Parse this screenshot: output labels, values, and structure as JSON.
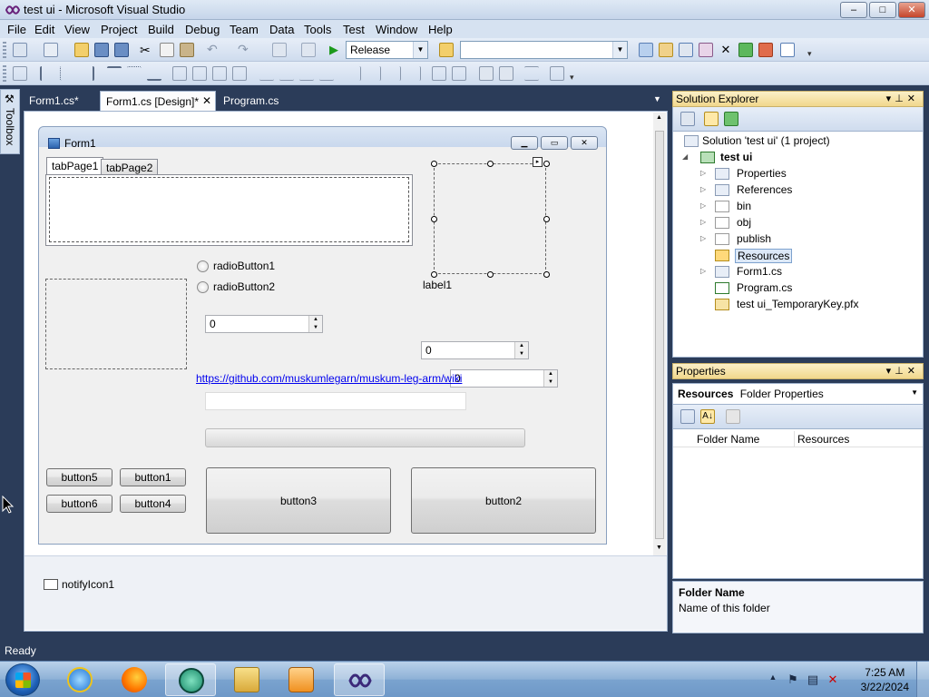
{
  "window": {
    "title": "test ui - Microsoft Visual Studio",
    "minimize": "‒",
    "maximize": "□",
    "close": "✕"
  },
  "menu": [
    "File",
    "Edit",
    "View",
    "Project",
    "Build",
    "Debug",
    "Team",
    "Data",
    "Tools",
    "Test",
    "Window",
    "Help"
  ],
  "toolbar": {
    "config_combo": "Release",
    "platform_combo": ""
  },
  "toolbox": {
    "label": "Toolbox"
  },
  "doc_tabs": [
    {
      "label": "Form1.cs*",
      "close": ""
    },
    {
      "label": "Form1.cs [Design]*",
      "close": "✕"
    },
    {
      "label": "Program.cs",
      "close": ""
    }
  ],
  "form": {
    "title": "Form1",
    "tabs": [
      "tabPage1",
      "tabPage2"
    ],
    "radio1": "radioButton1",
    "radio2": "radioButton2",
    "label1": "label1",
    "numeric1": "0",
    "numeric2": "0",
    "numeric3": "0",
    "link": "https://github.com/muskumlegarn/muskum-leg-arm/wiki",
    "buttons": {
      "b5": "button5",
      "b1": "button1",
      "b6": "button6",
      "b4": "button4",
      "b3": "button3",
      "b2": "button2"
    }
  },
  "component_tray": {
    "notify": "notifyIcon1"
  },
  "solution_explorer": {
    "title": "Solution Explorer",
    "items": [
      {
        "label": "Solution 'test ui' (1 project)",
        "twisty": ""
      },
      {
        "label": "test ui",
        "twisty": "◢"
      },
      {
        "label": "Properties",
        "twisty": "▷"
      },
      {
        "label": "References",
        "twisty": "▷"
      },
      {
        "label": "bin",
        "twisty": "▷"
      },
      {
        "label": "obj",
        "twisty": "▷"
      },
      {
        "label": "publish",
        "twisty": "▷"
      },
      {
        "label": "Resources",
        "twisty": ""
      },
      {
        "label": "Form1.cs",
        "twisty": "▷"
      },
      {
        "label": "Program.cs",
        "twisty": ""
      },
      {
        "label": "test ui_TemporaryKey.pfx",
        "twisty": ""
      }
    ]
  },
  "properties": {
    "title": "Properties",
    "object_name": "Resources",
    "object_type": "Folder Properties",
    "row_name": "Folder Name",
    "row_value": "Resources",
    "desc_title": "Folder Name",
    "desc_text": "Name of this folder"
  },
  "status": {
    "text": "Ready"
  },
  "clock": {
    "time": "7:25 AM",
    "date": "3/22/2024"
  },
  "colors": {
    "vs_chrome": "#2b3c59",
    "panel_header": "#f1d78c",
    "link": "#0000ee"
  }
}
